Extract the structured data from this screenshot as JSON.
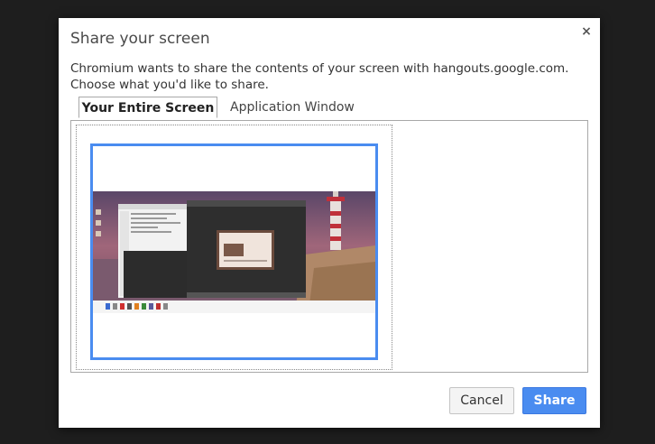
{
  "dialog": {
    "title": "Share your screen",
    "close_symbol": "×",
    "description": "Chromium wants to share the contents of your screen with hangouts.google.com. Choose what you'd like to share."
  },
  "tabs": [
    {
      "label": "Your Entire Screen",
      "active": true
    },
    {
      "label": "Application Window",
      "active": false
    }
  ],
  "buttons": {
    "cancel_label": "Cancel",
    "share_label": "Share"
  },
  "colors": {
    "accent": "#4a8cf0",
    "backdrop": "#1e1e1e"
  }
}
